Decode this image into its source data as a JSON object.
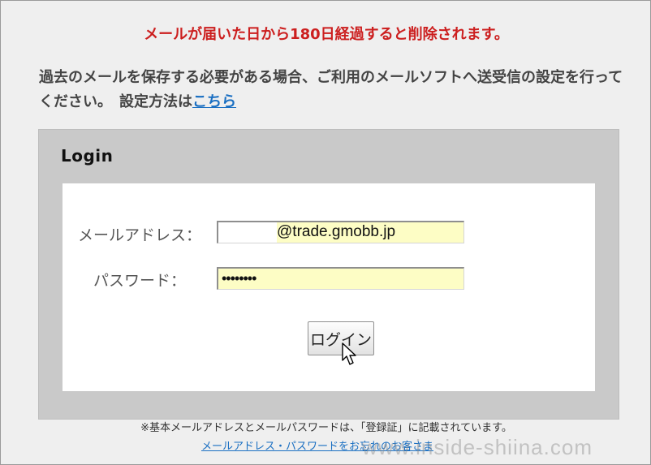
{
  "notice": {
    "retention": "メールが届いた日から180日経過すると削除されます。"
  },
  "instructions": {
    "text": "過去のメールを保存する必要がある場合、ご利用のメールソフトへ送受信の設定を行ってください。　設定方法は",
    "link_label": "こちら"
  },
  "login": {
    "title": "Login",
    "email_label": "メールアドレス：",
    "email_value": "@trade.gmobb.jp",
    "password_label": "パスワード：",
    "password_value": "••••••••",
    "button_label": "ログイン"
  },
  "footer": {
    "note": "※基本メールアドレスとメールパスワードは、「登録証」に記載されています。",
    "forgot_link": "メールアドレス・パスワードをお忘れのお客さま"
  },
  "watermark": {
    "text": "www.inside-shiina.com"
  },
  "colors": {
    "notice_red": "#cc1f1f",
    "link_blue": "#1a6fc2",
    "input_yellow": "#fdfdc5",
    "panel_gray": "#c9c9c9"
  },
  "icons": {
    "cursor": "mouse-pointer-icon"
  }
}
